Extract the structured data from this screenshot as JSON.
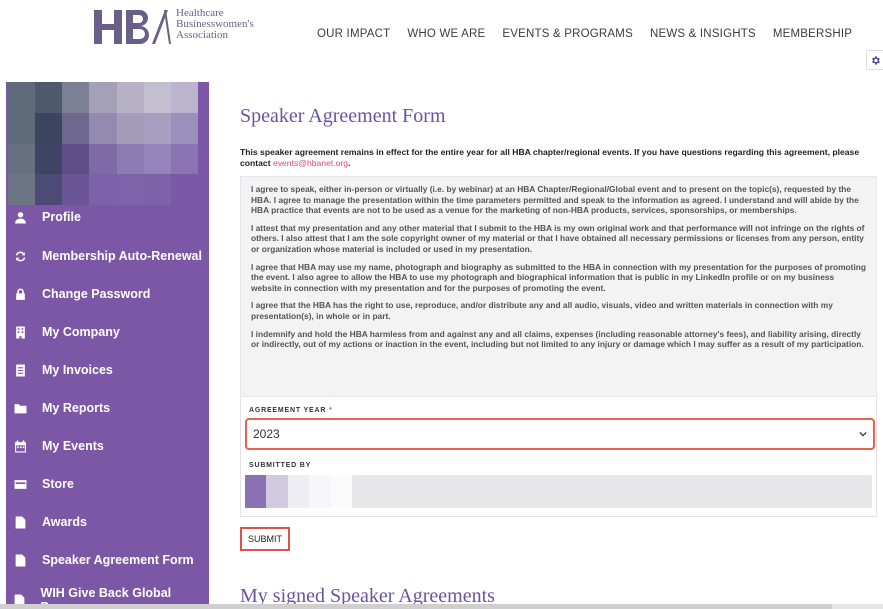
{
  "logo": {
    "line1": "Healthcare",
    "line2": "Businesswomen's",
    "line3": "Association"
  },
  "nav": [
    "OUR IMPACT",
    "WHO WE ARE",
    "EVENTS & PROGRAMS",
    "NEWS & INSIGHTS",
    "MEMBERSHIP"
  ],
  "sidebar": {
    "items": [
      {
        "label": "Profile",
        "icon": "user-icon"
      },
      {
        "label": "Membership Auto-Renewal",
        "icon": "refresh-icon"
      },
      {
        "label": "Change Password",
        "icon": "lock-icon"
      },
      {
        "label": "My Company",
        "icon": "building-icon"
      },
      {
        "label": "My Invoices",
        "icon": "receipt-icon"
      },
      {
        "label": "My Reports",
        "icon": "folder-icon"
      },
      {
        "label": "My Events",
        "icon": "calendar-icon"
      },
      {
        "label": "Store",
        "icon": "card-icon"
      },
      {
        "label": "Awards",
        "icon": "file-icon"
      },
      {
        "label": "Speaker Agreement Form",
        "icon": "file-icon"
      },
      {
        "label": "WIH Give Back Global Program",
        "icon": "file-icon"
      }
    ]
  },
  "main": {
    "title": "Speaker Agreement Form",
    "intro": "This speaker agreement remains in effect for the entire year for all HBA chapter/regional events. If you have questions regarding this agreement, please contact ",
    "intro_email": "events@hbanet.org",
    "intro_end": ".",
    "terms": [
      "I agree to speak, either in-person or virtually (i.e. by webinar) at an HBA Chapter/Regional/Global event and to present on the topic(s), requested by the HBA. I agree to manage the presentation within the time parameters permitted and speak to the information as agreed. I understand and will abide by the HBA practice that events are not to be used as a venue for the marketing of non-HBA products, services, sponsorships, or memberships.",
      "I attest that my presentation and any other material that I submit to the HBA is my own original work and that performance will not infringe on the rights of others. I also attest that I am the sole copyright owner of my material or that I have obtained all necessary permissions or licenses from any person, entity or organization whose material is included or used in my presentation.",
      "I agree that HBA may use my name, photograph and biography as submitted to the HBA in connection with my presentation for the purposes of promoting the event. I also agree to allow the HBA to use my photograph and biographical information that is public in my LinkedIn profile or on my business website in connection with my presentation and for the purposes of promoting the event.",
      "I agree that the HBA has the right to use, reproduce, and/or distribute any and all audio, visuals, video and written materials in connection with my presentation(s), in whole or in part.",
      "I indemnify and hold the HBA harmless from and against any and all claims, expenses (including reasonable attorney's fees), and liability arising, directly or indirectly, out of my actions or inaction in the event, including but not limited to any injury or damage which I may suffer as a result of my participation."
    ],
    "agreement_year_label": "AGREEMENT YEAR",
    "agreement_year_required": "*",
    "agreement_year_value": "2023",
    "submitted_by_label": "SUBMITTED BY",
    "submit_label": "SUBMIT",
    "signed_title": "My signed Speaker Agreements"
  },
  "colors": {
    "brand_purple": "#7b57a6",
    "title_purple": "#6c52a0",
    "link_pink": "#e0457a",
    "highlight_red": "#e5634f"
  }
}
